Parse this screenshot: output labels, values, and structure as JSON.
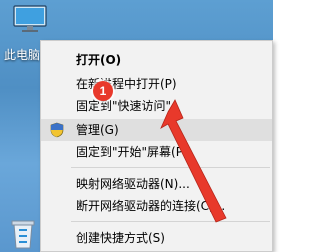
{
  "desktop": {
    "this_pc_label": "此电脑"
  },
  "context_menu": {
    "items": [
      {
        "label": "打开(O)"
      },
      {
        "label": "在新进程中打开(P)"
      },
      {
        "label": "固定到\"快速访问\""
      },
      {
        "label": "管理(G)"
      },
      {
        "label": "固定到\"开始\"屏幕(P)"
      },
      {
        "label": "映射网络驱动器(N)..."
      },
      {
        "label": "断开网络驱动器的连接(C)..."
      },
      {
        "label": "创建快捷方式(S)"
      }
    ]
  },
  "annotation": {
    "step_number": "1",
    "color": "#e8392b"
  }
}
